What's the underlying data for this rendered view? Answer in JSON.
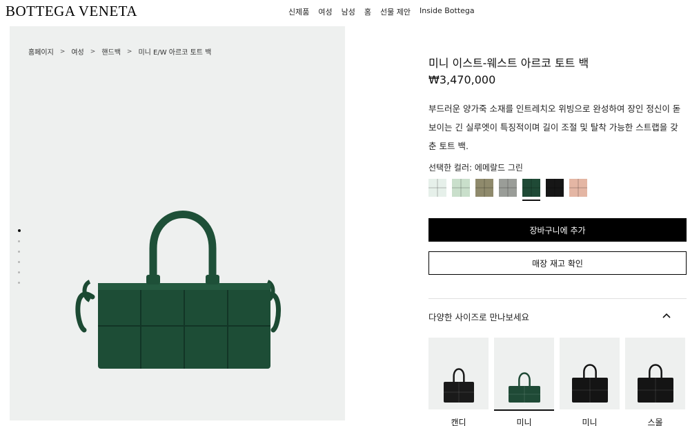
{
  "header": {
    "logo": "BOTTEGA VENETA",
    "nav": [
      "신제품",
      "여성",
      "남성",
      "홈",
      "선물 제안",
      "Inside Bottega"
    ]
  },
  "breadcrumb": [
    "홈페이지",
    "여성",
    "핸드백",
    "미니 E/W 아르코 토트 백"
  ],
  "gallery": {
    "image_count": 6,
    "active_index": 0
  },
  "product": {
    "title": "미니 이스트-웨스트 아르코 토트 백",
    "price": "₩3,470,000",
    "description": "부드러운 양가죽 소재를 인트레치오 위빙으로 완성하여 장인 정신이 돋보이는 긴 실루엣이 특징적이며 길이 조절 및 탈착 가능한 스트랩을 갖춘 토트 백.",
    "color_label": "선택한 컬러: 에메랄드 그린",
    "colors": [
      "#e6f0ea",
      "#c9dfcb",
      "#8f8a6c",
      "#9a9d98",
      "#1f4a36",
      "#161616",
      "#e4b6a4"
    ],
    "selected_color_index": 4
  },
  "buttons": {
    "add_to_cart": "장바구니에 추가",
    "check_stock": "매장 재고 확인"
  },
  "sizes": {
    "heading": "다양한 사이즈로 만나보세요",
    "items": [
      {
        "label": "캔디",
        "color": "#1a1a1a"
      },
      {
        "label": "미니",
        "color": "#1f4a36"
      },
      {
        "label": "미니",
        "color": "#141414"
      },
      {
        "label": "스몰",
        "color": "#141414"
      }
    ],
    "active_index": 1
  }
}
